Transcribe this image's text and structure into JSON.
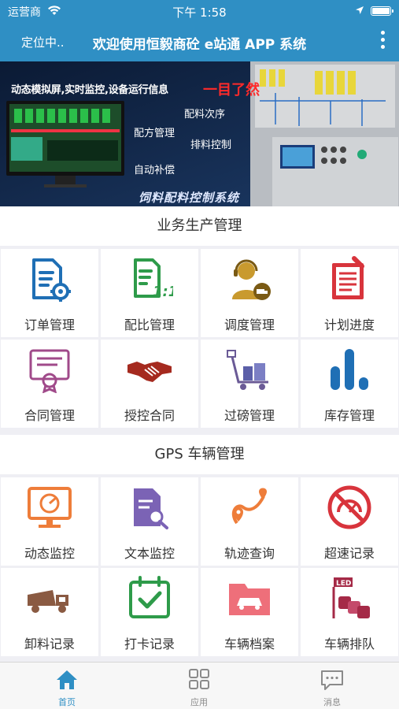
{
  "status_bar": {
    "carrier": "运营商",
    "time": "下午 1:58"
  },
  "navbar": {
    "location": "定位中..",
    "title": "欢迎使用恒毅商砼 e站通 APP 系统"
  },
  "banner": {
    "slogan": "动态模拟屏,实时监控,设备运行信息",
    "highlight": "一目了然",
    "labels": [
      "配料次序",
      "配方管理",
      "排料控制",
      "自动补偿"
    ],
    "caption": "饲料配料控制系统"
  },
  "sections": [
    {
      "title": "业务生产管理",
      "items": [
        {
          "label": "订单管理",
          "icon": "order-doc-gear-icon"
        },
        {
          "label": "配比管理",
          "icon": "ratio-doc-icon"
        },
        {
          "label": "调度管理",
          "icon": "dispatcher-headset-icon"
        },
        {
          "label": "计划进度",
          "icon": "plan-notepad-icon"
        },
        {
          "label": "合同管理",
          "icon": "contract-certificate-icon"
        },
        {
          "label": "授控合同",
          "icon": "handshake-icon"
        },
        {
          "label": "过磅管理",
          "icon": "weighbridge-cart-icon"
        },
        {
          "label": "库存管理",
          "icon": "inventory-silos-icon"
        }
      ]
    },
    {
      "title": "GPS 车辆管理",
      "items": [
        {
          "label": "动态监控",
          "icon": "radar-monitor-icon"
        },
        {
          "label": "文本监控",
          "icon": "doc-search-icon"
        },
        {
          "label": "轨迹查询",
          "icon": "route-pin-icon"
        },
        {
          "label": "超速记录",
          "icon": "no-speeding-icon"
        },
        {
          "label": "卸料记录",
          "icon": "dump-truck-icon"
        },
        {
          "label": "打卡记录",
          "icon": "calendar-check-icon"
        },
        {
          "label": "车辆档案",
          "icon": "car-folder-icon"
        },
        {
          "label": "车辆排队",
          "icon": "vehicle-queue-icon"
        }
      ]
    }
  ],
  "tabbar": [
    {
      "label": "首页",
      "icon": "home-icon",
      "active": true
    },
    {
      "label": "应用",
      "icon": "apps-grid-icon",
      "active": false
    },
    {
      "label": "消息",
      "icon": "message-icon",
      "active": false
    }
  ],
  "colors": {
    "brand": "#2f8fc4",
    "icon_blue": "#1f6fb5",
    "icon_green": "#2e9b4a",
    "icon_gold": "#c99a2e",
    "icon_red": "#d8343c",
    "icon_orange": "#ee7d3a",
    "icon_purple": "#7b63b5",
    "icon_maroon": "#a52a47"
  }
}
